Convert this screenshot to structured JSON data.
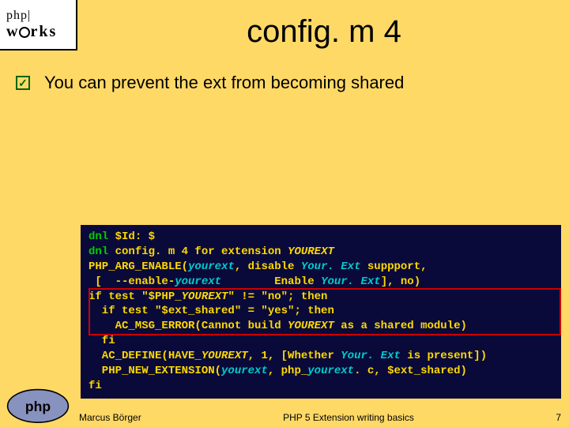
{
  "logo": {
    "line1": "php|",
    "line2_pre": "w",
    "line2_post": "rks"
  },
  "title": "config. m 4",
  "bullet": "You can prevent the ext from becoming shared",
  "code": {
    "l1a": "dnl",
    "l1b": " $Id: $",
    "l2a": "dnl",
    "l2b": " config. m 4 for extension ",
    "l2c": "YOUREXT",
    "l3a": "PHP_ARG_ENABLE(",
    "l3b": "yourext",
    "l3c": ", disable ",
    "l3d": "Your. Ext",
    "l3e": " suppport,",
    "l4a": " [  --enable-",
    "l4b": "yourext",
    "l4c": "        Enable ",
    "l4d": "Your. Ext",
    "l4e": "], no)",
    "l5a": "if test \"$PHP_",
    "l5b": "YOUREXT",
    "l5c": "\" != \"no\"; then",
    "l6": "  if test \"$ext_shared\" = \"yes\"; then",
    "l7a": "    AC_MSG_ERROR(Cannot build ",
    "l7b": "YOUREXT",
    "l7c": " as a shared module)",
    "l8": "  fi",
    "l9a": "  AC_DEFINE(HAVE_",
    "l9b": "YOUREXT",
    "l9c": ", 1, [Whether ",
    "l9d": "Your. Ext",
    "l9e": " is present])",
    "l10a": "  PHP_NEW_EXTENSION(",
    "l10b": "yourext",
    "l10c": ", php_",
    "l10d": "yourext",
    "l10e": ". c, $ext_shared)",
    "l11": "fi"
  },
  "footer": {
    "author": "Marcus Börger",
    "center": "PHP 5 Extension writing basics",
    "page": "7"
  }
}
